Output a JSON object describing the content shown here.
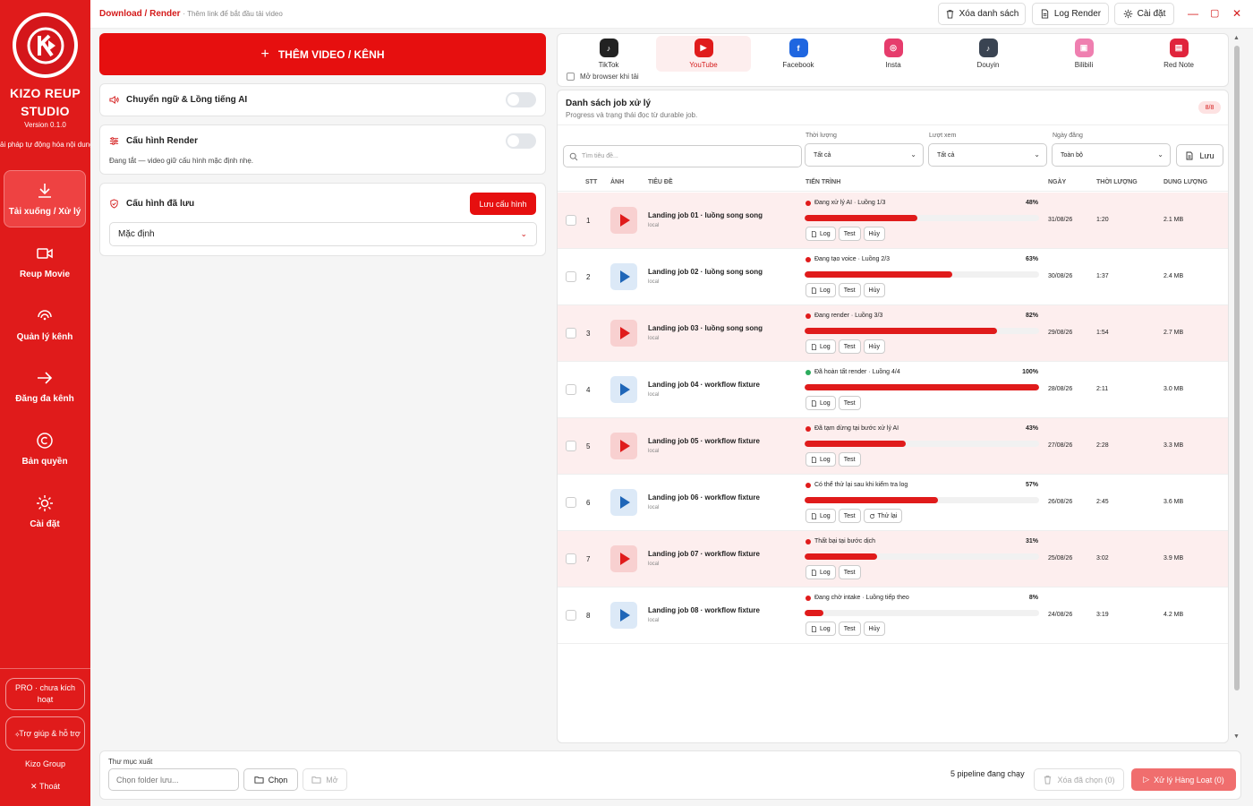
{
  "sidebar": {
    "brand": "KIZO REUP STUDIO",
    "version": "Version 0.1.0",
    "tagline": "Giải pháp tự động hóa nội dung",
    "nav": [
      {
        "label": "Tải xuống / Xử lý",
        "icon": "download-icon",
        "active": true
      },
      {
        "label": "Reup Movie",
        "icon": "video-icon",
        "active": false
      },
      {
        "label": "Quản lý kênh",
        "icon": "signal-icon",
        "active": false
      },
      {
        "label": "Đăng đa kênh",
        "icon": "arrow-right-icon",
        "active": false
      },
      {
        "label": "Bản quyền",
        "icon": "copyright-icon",
        "active": false
      },
      {
        "label": "Cài đặt",
        "icon": "settings-icon",
        "active": false
      }
    ],
    "pro": "PRO · chưa kích hoạt",
    "help": "Trợ giúp & hỗ trợ",
    "group": "Kizo Group",
    "logout": "Thoát"
  },
  "topbar": {
    "crumb": "Download / Render",
    "hint": "· Thêm link để bắt đầu tải video",
    "clear_list": "Xóa danh sách",
    "log_render": "Log Render",
    "settings": "Cài đặt"
  },
  "left": {
    "add_button": "THÊM VIDEO / KÊNH",
    "translate_title": "Chuyển ngữ & Lồng tiếng AI",
    "render_title": "Cấu hình Render",
    "render_desc": "Đang tắt — video giữ cấu hình mặc định nhẹ.",
    "saved_title": "Cấu hình đã lưu",
    "save_config": "Lưu cấu hình",
    "config_value": "Mặc định"
  },
  "platforms": {
    "items": [
      {
        "label": "TikTok",
        "color": "#222222",
        "glyph": "♪"
      },
      {
        "label": "YouTube",
        "color": "#e01b1b",
        "glyph": "▶"
      },
      {
        "label": "Facebook",
        "color": "#1f66e0",
        "glyph": "f"
      },
      {
        "label": "Insta",
        "color": "#e63c6c",
        "glyph": "◎"
      },
      {
        "label": "Douyin",
        "color": "#3a4452",
        "glyph": "♪"
      },
      {
        "label": "Bilibili",
        "color": "#ef7fb0",
        "glyph": "▣"
      },
      {
        "label": "Red Note",
        "color": "#e0243c",
        "glyph": "▤"
      }
    ],
    "active_index": 1,
    "open_browser": "Mở browser khi tải"
  },
  "jobs": {
    "title": "Danh sách job xử lý",
    "subtitle": "Progress và trạng thái đọc từ durable job.",
    "count": "8/8",
    "search_placeholder": "Tìm tiêu đề...",
    "filters": [
      {
        "label": "Thời lượng",
        "value": "Tất cả"
      },
      {
        "label": "Lượt xem",
        "value": "Tất cả"
      },
      {
        "label": "Ngày đăng",
        "value": "Toàn bộ"
      }
    ],
    "save_filter": "Lưu",
    "columns": [
      "STT",
      "ẢNH",
      "TIÊU ĐỀ",
      "TIẾN TRÌNH",
      "NGÀY",
      "THỜI LƯỢNG",
      "DUNG LƯỢNG"
    ],
    "rows": [
      {
        "stt": "1",
        "title": "Landing job 01 · luồng song song",
        "src": "local",
        "status": "Đang xử lý AI · Luồng 1/3",
        "pct": "48%",
        "progress": 48,
        "date": "31/08/26",
        "duration": "1:20",
        "size": "2.1 MB",
        "thumb": "red",
        "done": false,
        "actions": [
          "Log",
          "Test",
          "Hủy"
        ]
      },
      {
        "stt": "2",
        "title": "Landing job 02 · luồng song song",
        "src": "local",
        "status": "Đang tạo voice · Luồng 2/3",
        "pct": "63%",
        "progress": 63,
        "date": "30/08/26",
        "duration": "1:37",
        "size": "2.4 MB",
        "thumb": "blue",
        "done": false,
        "actions": [
          "Log",
          "Test",
          "Hủy"
        ]
      },
      {
        "stt": "3",
        "title": "Landing job 03 · luồng song song",
        "src": "local",
        "status": "Đang render · Luồng 3/3",
        "pct": "82%",
        "progress": 82,
        "date": "29/08/26",
        "duration": "1:54",
        "size": "2.7 MB",
        "thumb": "red",
        "done": false,
        "actions": [
          "Log",
          "Test",
          "Hủy"
        ]
      },
      {
        "stt": "4",
        "title": "Landing job 04 · workflow fixture",
        "src": "local",
        "status": "Đã hoàn tất render · Luồng 4/4",
        "pct": "100%",
        "progress": 100,
        "date": "28/08/26",
        "duration": "2:11",
        "size": "3.0 MB",
        "thumb": "blue",
        "done": true,
        "actions": [
          "Log",
          "Test"
        ]
      },
      {
        "stt": "5",
        "title": "Landing job 05 · workflow fixture",
        "src": "local",
        "status": "Đã tạm dừng tại bước xử lý AI",
        "pct": "43%",
        "progress": 43,
        "date": "27/08/26",
        "duration": "2:28",
        "size": "3.3 MB",
        "thumb": "red",
        "done": false,
        "actions": [
          "Log",
          "Test"
        ]
      },
      {
        "stt": "6",
        "title": "Landing job 06 · workflow fixture",
        "src": "local",
        "status": "Có thể thử lại sau khi kiểm tra log",
        "pct": "57%",
        "progress": 57,
        "date": "26/08/26",
        "duration": "2:45",
        "size": "3.6 MB",
        "thumb": "blue",
        "done": false,
        "actions": [
          "Log",
          "Test",
          "Thử lại"
        ]
      },
      {
        "stt": "7",
        "title": "Landing job 07 · workflow fixture",
        "src": "local",
        "status": "Thất bại tại bước dịch",
        "pct": "31%",
        "progress": 31,
        "date": "25/08/26",
        "duration": "3:02",
        "size": "3.9 MB",
        "thumb": "red",
        "done": false,
        "actions": [
          "Log",
          "Test"
        ]
      },
      {
        "stt": "8",
        "title": "Landing job 08 · workflow fixture",
        "src": "local",
        "status": "Đang chờ intake · Luồng tiếp theo",
        "pct": "8%",
        "progress": 8,
        "date": "24/08/26",
        "duration": "3:19",
        "size": "4.2 MB",
        "thumb": "blue",
        "done": false,
        "actions": [
          "Log",
          "Test",
          "Hủy"
        ]
      }
    ]
  },
  "bottom": {
    "output_label": "Thư mục xuất",
    "folder_placeholder": "Chọn folder lưu...",
    "choose": "Chọn",
    "open": "Mở",
    "pipeline": "5 pipeline đang chạy",
    "delete_selected": "Xóa đã chọn (0)",
    "batch": "Xử lý Hàng Loạt (0)"
  },
  "colors": {
    "accent": "#e01b1b",
    "done": "#2bab5c",
    "row_alt": "#fdeeee"
  }
}
